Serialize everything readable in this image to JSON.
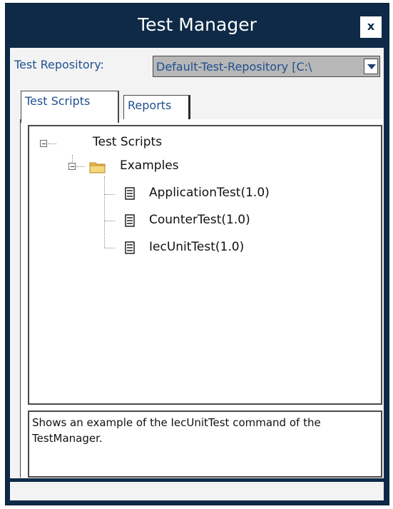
{
  "window": {
    "title": "Test Manager",
    "close_label": "x",
    "colors": {
      "titlebar": "#0e2a47",
      "panel": "#f3f3f3",
      "accent_text": "#1f4f8f"
    }
  },
  "repository": {
    "label": "Test Repository:",
    "selected": "Default-Test-Repository [C:\\"
  },
  "tabs": [
    {
      "label": "Test Scripts",
      "active": true
    },
    {
      "label": "Reports",
      "active": false
    }
  ],
  "tree": {
    "root": {
      "label": "Test Scripts",
      "icon": "minus-expander-icon"
    },
    "folder": {
      "label": "Examples",
      "icon": "folder-icon"
    },
    "items": [
      {
        "label": "ApplicationTest(1.0)",
        "icon": "document-icon"
      },
      {
        "label": "CounterTest(1.0)",
        "icon": "document-icon"
      },
      {
        "label": "IecUnitTest(1.0)",
        "icon": "document-icon"
      }
    ]
  },
  "description": "Shows an example of the IecUnitTest command of the TestManager."
}
